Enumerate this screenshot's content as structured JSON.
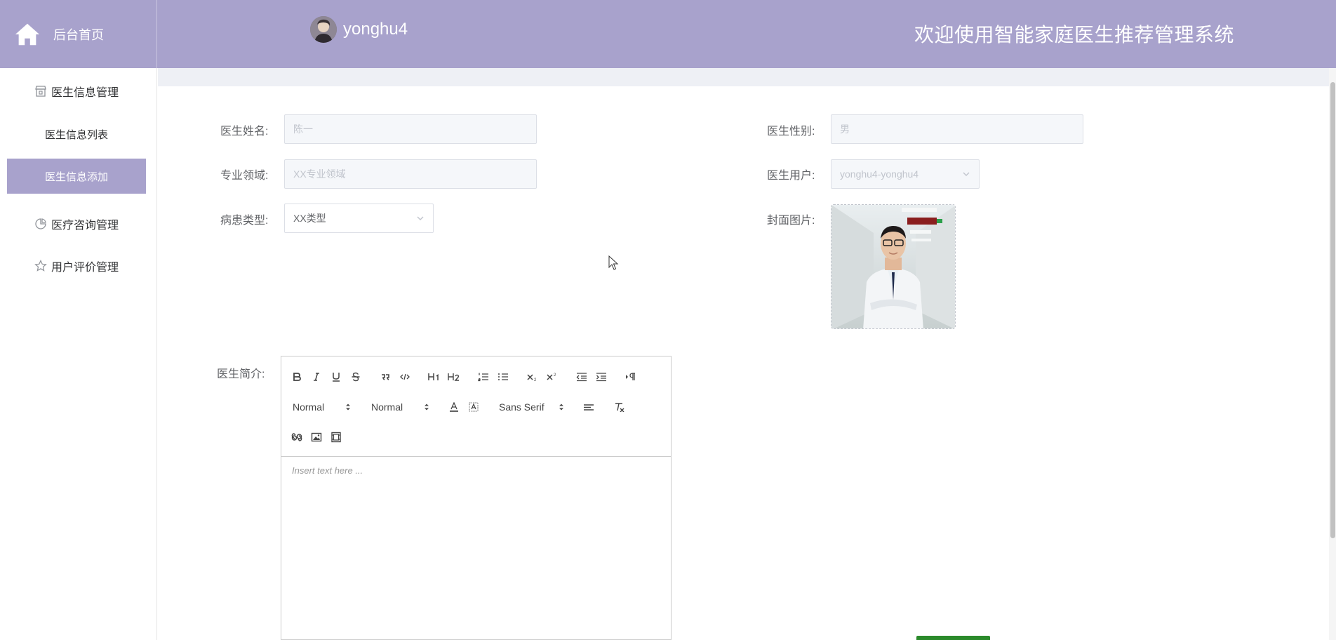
{
  "header": {
    "home_label": "后台首页",
    "username": "yonghu4",
    "system_title": "欢迎使用智能家庭医生推荐管理系统"
  },
  "sidebar": {
    "items": [
      {
        "label": "医生信息管理"
      },
      {
        "label": "医生信息列表"
      },
      {
        "label": "医生信息添加"
      },
      {
        "label": "医疗咨询管理"
      },
      {
        "label": "用户评价管理"
      }
    ]
  },
  "form": {
    "name": {
      "label": "医生姓名:",
      "value": "陈一"
    },
    "gender": {
      "label": "医生性别:",
      "value": "男"
    },
    "field": {
      "label": "专业领域:",
      "value": "XX专业领域"
    },
    "doctor_user": {
      "label": "医生用户:",
      "value": "yonghu4-yonghu4"
    },
    "disease_type": {
      "label": "病患类型:",
      "value": "XX类型"
    },
    "cover": {
      "label": "封面图片:"
    },
    "intro": {
      "label": "医生简介:",
      "placeholder": "Insert text here ..."
    }
  },
  "editor": {
    "header_picker": "Normal",
    "size_picker": "Normal",
    "font_picker": "Sans Serif"
  },
  "colors": {
    "accent": "#a8a2cc",
    "header_text": "#ffffff"
  }
}
